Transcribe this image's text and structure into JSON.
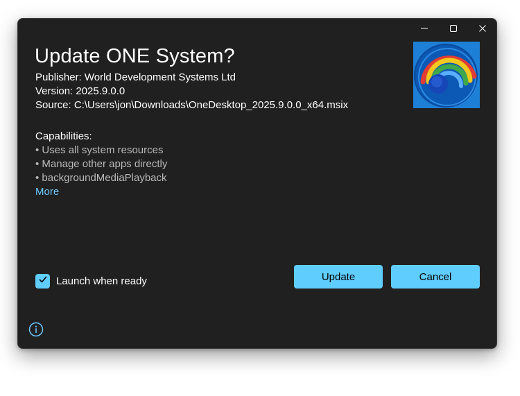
{
  "window": {
    "controls": {
      "minimize_icon": "minimize-icon",
      "maximize_icon": "maximize-icon",
      "close_icon": "close-icon"
    }
  },
  "header": {
    "title": "Update ONE System?"
  },
  "details": {
    "publisher": "Publisher: World Development Systems Ltd",
    "version": "Version: 2025.9.0.0",
    "source": "Source: C:\\Users\\jon\\Downloads\\OneDesktop_2025.9.0.0_x64.msix"
  },
  "capabilities": {
    "heading": "Capabilities:",
    "items": [
      "• Uses all system resources",
      "• Manage other apps directly",
      "• backgroundMediaPlayback"
    ],
    "more_label": "More"
  },
  "launch_option": {
    "label": "Launch when ready",
    "checked": true
  },
  "actions": {
    "update_label": "Update",
    "cancel_label": "Cancel"
  },
  "footer": {
    "info_icon": "info-icon"
  },
  "colors": {
    "dialog_bg": "#202020",
    "accent": "#60cdff",
    "link": "#6cc7ff",
    "muted_text": "#b9b9b9"
  }
}
